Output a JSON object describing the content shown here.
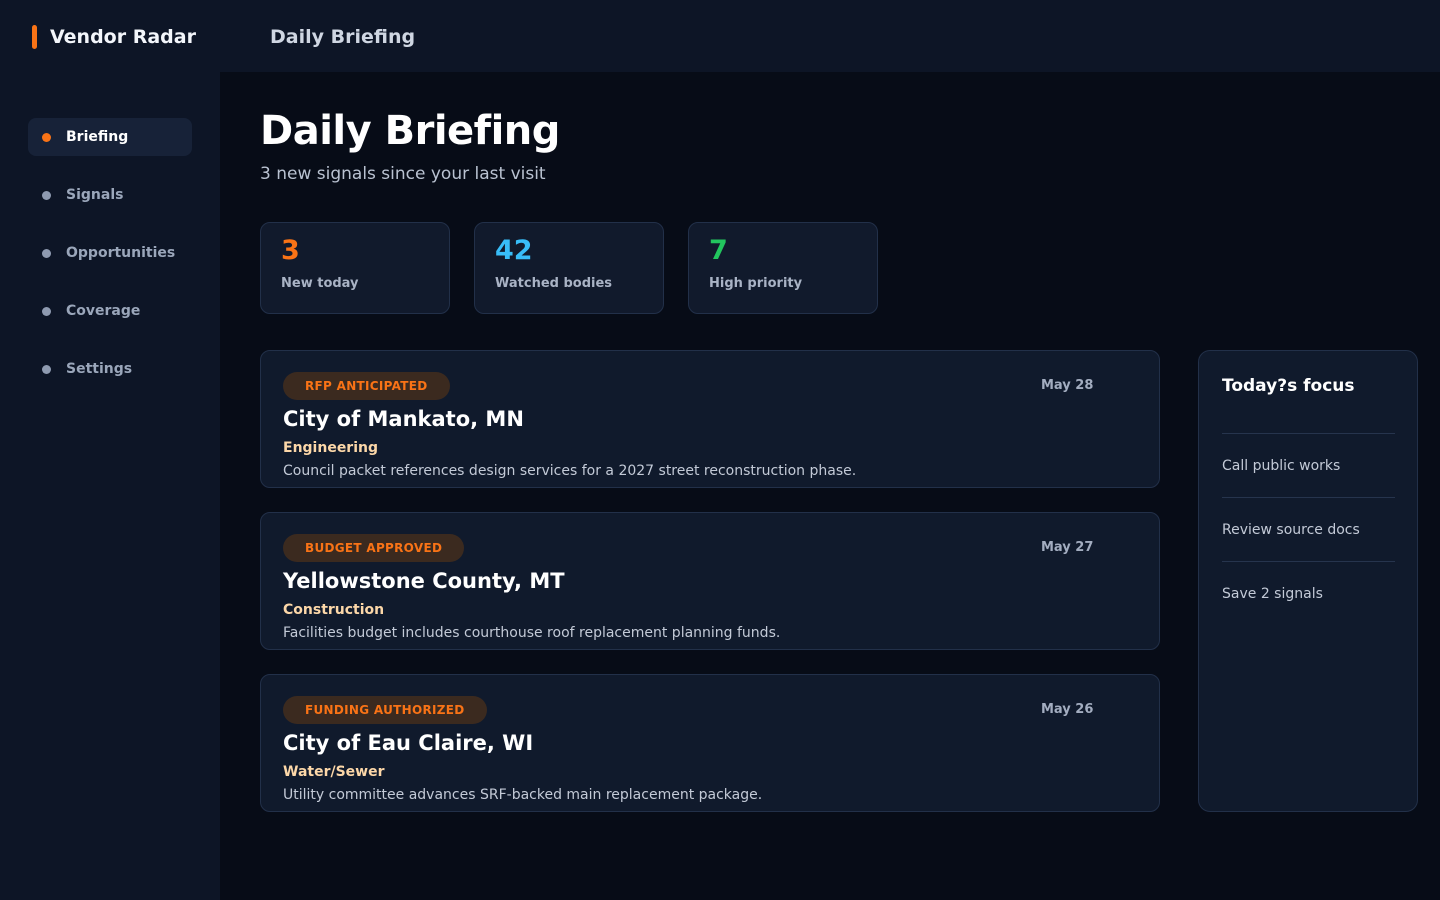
{
  "app": {
    "name": "Vendor Radar",
    "section_title": "Daily Briefing"
  },
  "colors": {
    "accent": "#f97316",
    "stat_new": "#f97316",
    "stat_watched": "#38bdf8",
    "stat_priority": "#22c55e"
  },
  "sidebar": {
    "items": [
      {
        "label": "Briefing",
        "active": true
      },
      {
        "label": "Signals"
      },
      {
        "label": "Opportunities"
      },
      {
        "label": "Coverage"
      },
      {
        "label": "Settings"
      }
    ]
  },
  "main": {
    "title": "Daily Briefing",
    "subtitle": "3 new signals since your last visit",
    "stats": [
      {
        "value": "3",
        "label": "New today"
      },
      {
        "value": "42",
        "label": "Watched bodies"
      },
      {
        "value": "7",
        "label": "High priority"
      }
    ],
    "signals": [
      {
        "badge": "RFP ANTICIPATED",
        "date": "May 28",
        "title": "City of Mankato, MN",
        "category": "Engineering",
        "description": "Council packet references design services for a 2027 street reconstruction phase."
      },
      {
        "badge": "BUDGET APPROVED",
        "date": "May 27",
        "title": "Yellowstone County, MT",
        "category": "Construction",
        "description": "Facilities budget includes courthouse roof replacement planning funds."
      },
      {
        "badge": "FUNDING AUTHORIZED",
        "date": "May 26",
        "title": "City of Eau Claire, WI",
        "category": "Water/Sewer",
        "description": "Utility committee advances SRF-backed main replacement package."
      }
    ]
  },
  "focus": {
    "title": "Today?s focus",
    "items": [
      "Call public works",
      "Review source docs",
      "Save 2 signals"
    ]
  }
}
